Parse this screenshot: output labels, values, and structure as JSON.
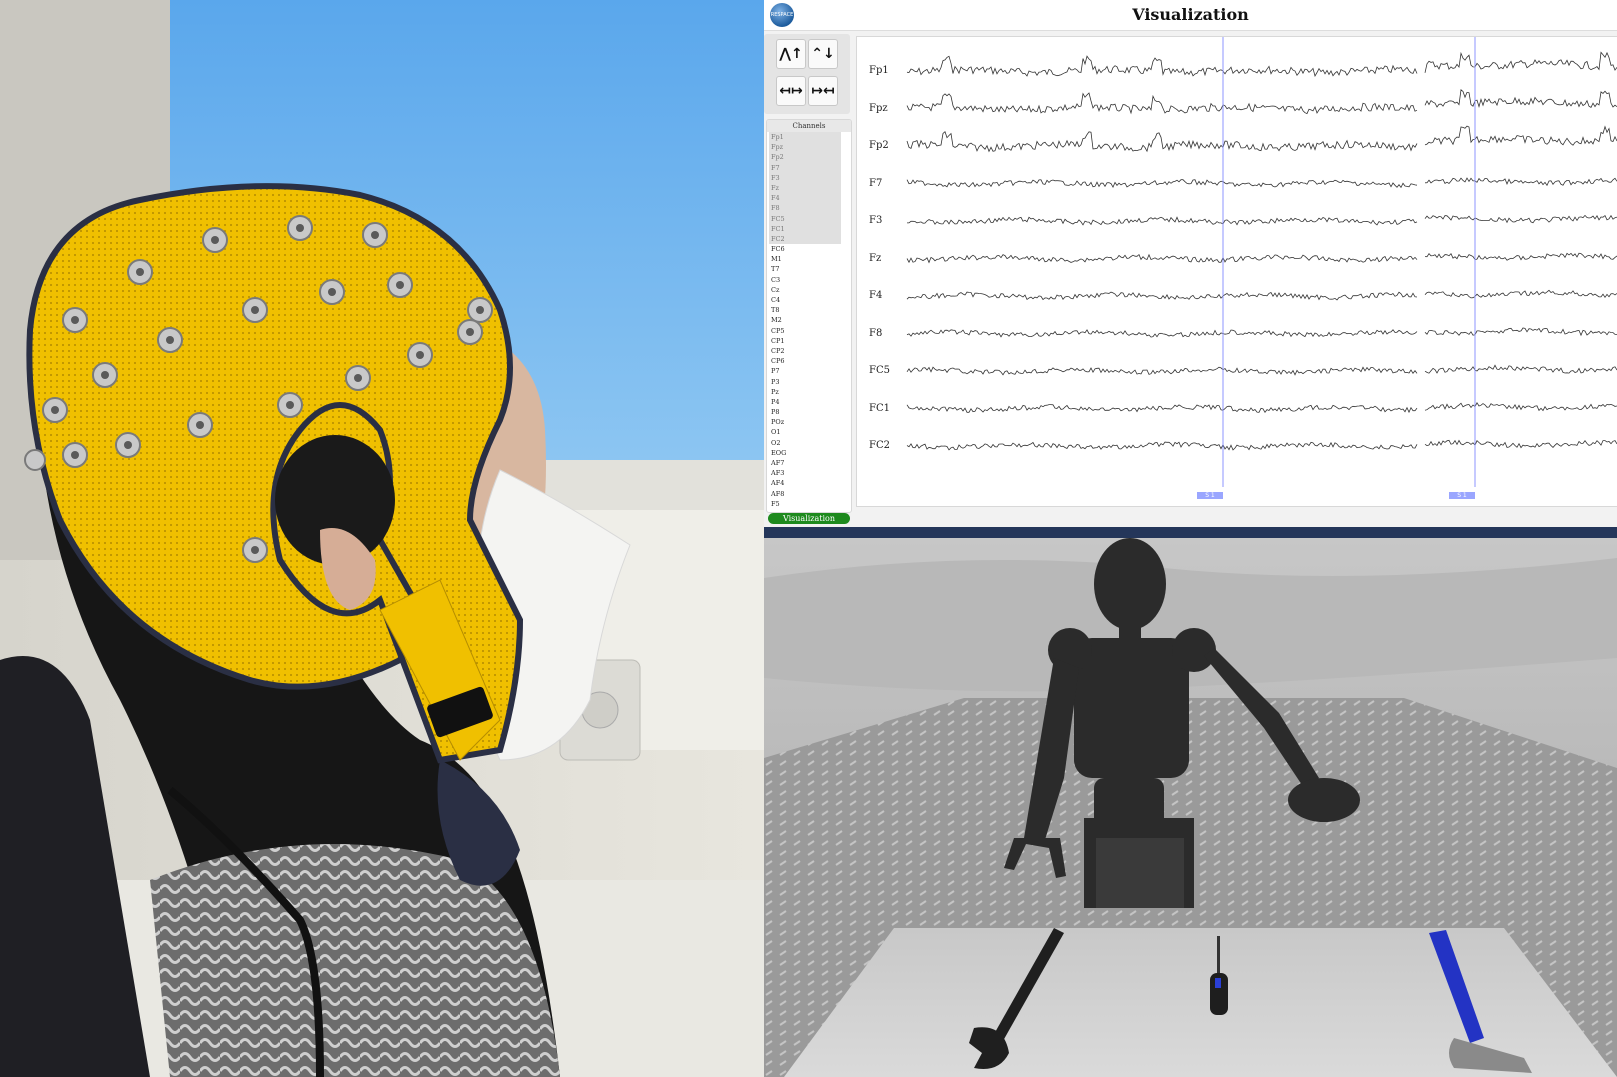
{
  "app": {
    "title": "Visualization",
    "logo_text": "RESPACE",
    "toolbar": [
      {
        "name": "amplitude-increase-button",
        "label": "⋀↑"
      },
      {
        "name": "amplitude-decrease-button",
        "label": "⌃↓"
      },
      {
        "name": "time-expand-button",
        "label": "↤↦"
      },
      {
        "name": "time-compress-button",
        "label": "↦↤"
      }
    ],
    "channels_title": "Channels",
    "channel_list": [
      "Fp1",
      "Fpz",
      "Fp2",
      "F7",
      "F3",
      "Fz",
      "F4",
      "F8",
      "FC5",
      "FC1",
      "FC2",
      "FC6",
      "M1",
      "T7",
      "C3",
      "Cz",
      "C4",
      "T8",
      "M2",
      "CP5",
      "CP1",
      "CP2",
      "CP6",
      "P7",
      "P3",
      "Pz",
      "P4",
      "P8",
      "POz",
      "O1",
      "O2",
      "EOG",
      "AF7",
      "AF3",
      "AF4",
      "AF8",
      "F5"
    ],
    "selected_channels": [
      "Fp1",
      "Fpz",
      "Fp2",
      "F7",
      "F3",
      "Fz",
      "F4",
      "F8",
      "FC5",
      "FC1",
      "FC2"
    ],
    "plotted_channels": [
      "Fp1",
      "Fpz",
      "Fp2",
      "F7",
      "F3",
      "Fz",
      "F4",
      "F8",
      "FC5",
      "FC1",
      "FC2"
    ],
    "markers": [
      {
        "label": "S 1"
      },
      {
        "label": "S 1"
      }
    ],
    "status_button": "Visualization"
  },
  "colors": {
    "cap_yellow": "#f2c400",
    "marker_line": "#8d96ff",
    "divider": "#24365a",
    "status_green": "#1e8a1e"
  },
  "scene": {
    "objects": [
      "robot",
      "wrench",
      "screwdriver",
      "hammer"
    ]
  }
}
